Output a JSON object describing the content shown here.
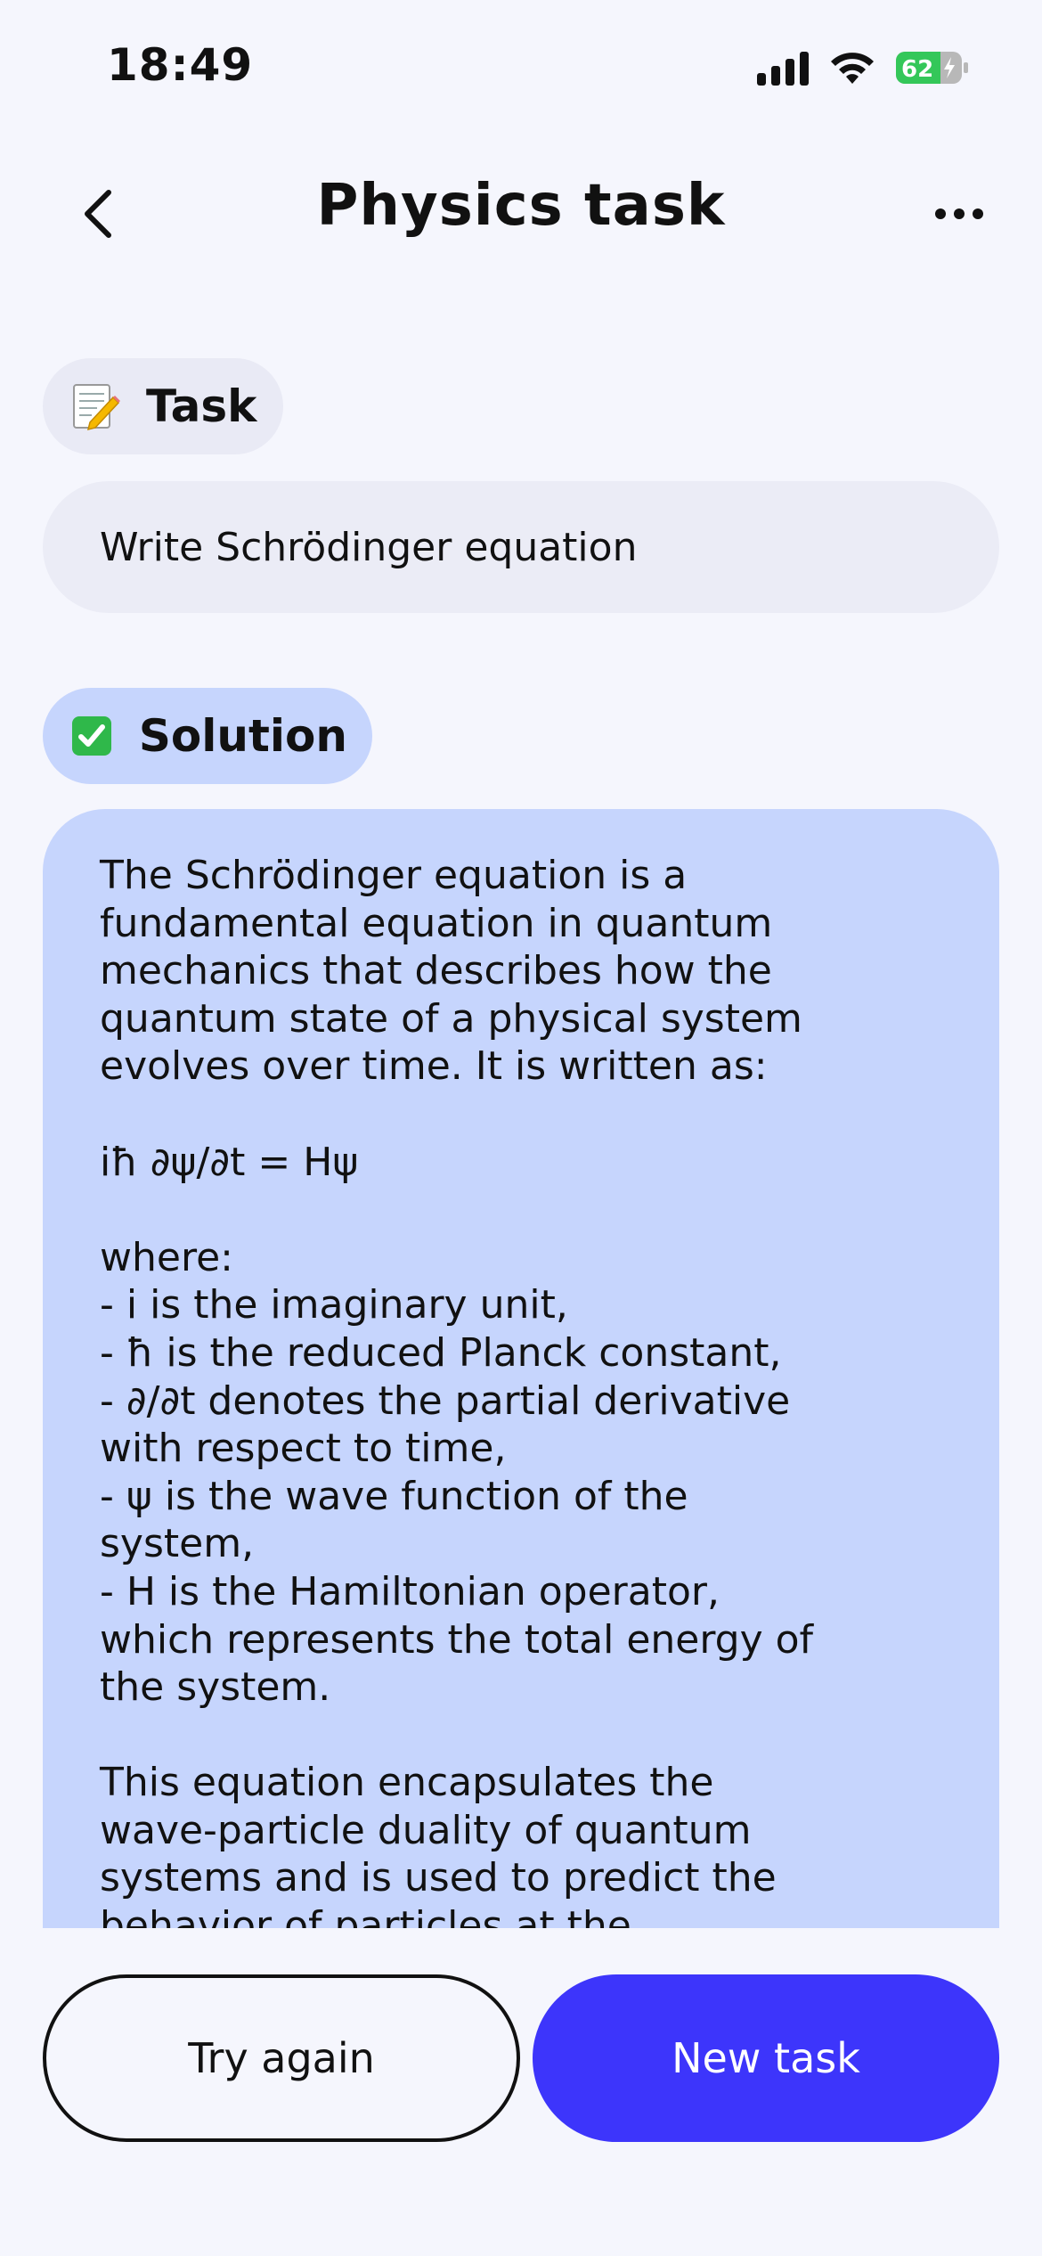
{
  "status_bar": {
    "time": "18:49",
    "battery_percent": "62"
  },
  "header": {
    "title": "Physics task"
  },
  "task_section": {
    "label": "Task",
    "icon": "memo-icon",
    "text": "Write Schrödinger equation"
  },
  "solution_section": {
    "label": "Solution",
    "icon": "check-mark-icon",
    "text": "The Schrödinger equation is a\nfundamental equation in quantum\nmechanics that describes how the\nquantum state of a physical system\nevolves over time. It is written as:\n\niħ ∂ψ/∂t = Hψ\n\nwhere:\n- i is the imaginary unit,\n- ħ is the reduced Planck constant,\n- ∂/∂t denotes the partial derivative\nwith respect to time,\n- ψ is the wave function of the\nsystem,\n- H is the Hamiltonian operator,\nwhich represents the total energy of\nthe system.\n\nThis equation encapsulates the\nwave-particle duality of quantum\nsystems and is used to predict the\nbehavior of particles at the"
  },
  "actions": {
    "try_again_label": "Try again",
    "new_task_label": "New task"
  },
  "colors": {
    "background": "#f5f6fd",
    "solution_bg": "#c6d5fd",
    "primary": "#3d35fb",
    "battery": "#34c759"
  }
}
